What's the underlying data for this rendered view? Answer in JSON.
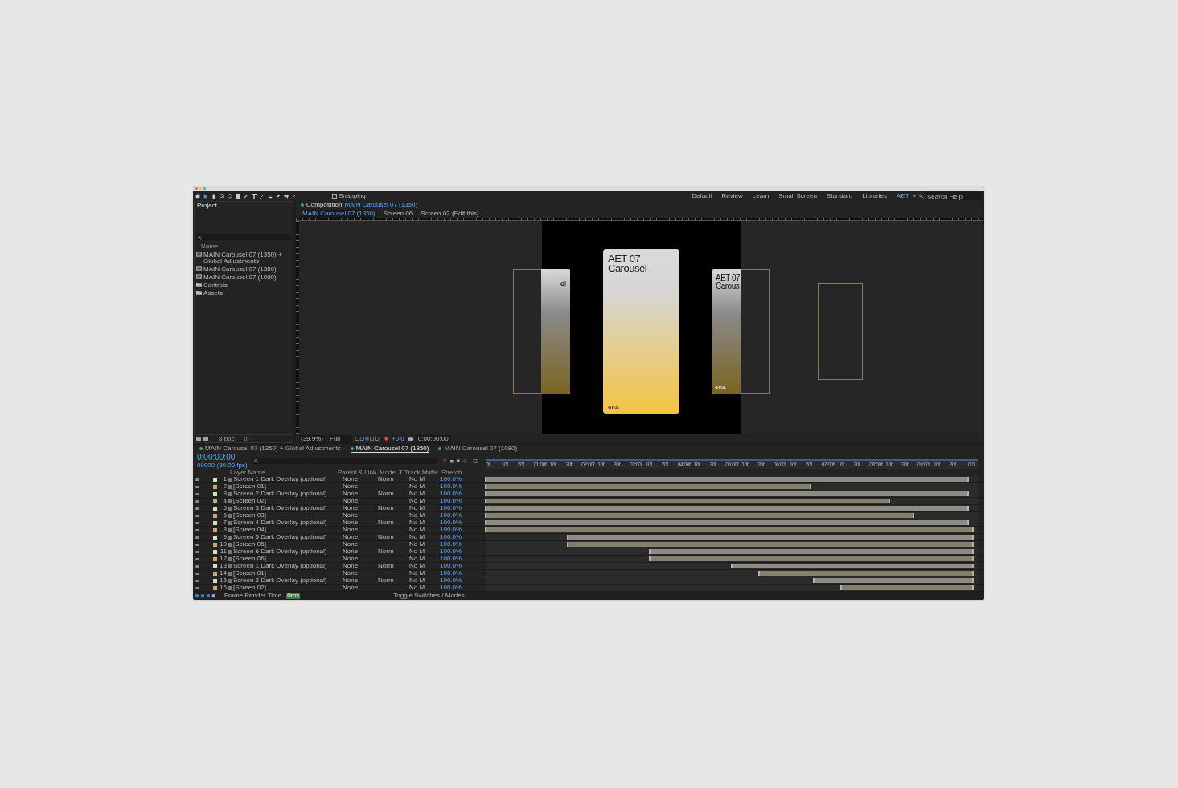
{
  "toolbar": {
    "snapping": {
      "label": "Snapping",
      "checked": false
    },
    "workspaces": [
      {
        "label": "Default",
        "selected": false
      },
      {
        "label": "Review",
        "selected": false
      },
      {
        "label": "Learn",
        "selected": false
      },
      {
        "label": "Small Screen",
        "selected": false
      },
      {
        "label": "Standard",
        "selected": false
      },
      {
        "label": "Libraries",
        "selected": false
      },
      {
        "label": "AET",
        "selected": true
      }
    ],
    "more": "»",
    "search": {
      "placeholder": "Search Help"
    }
  },
  "project": {
    "title": "Project",
    "name_column": "Name",
    "items": [
      {
        "kind": "comp",
        "label": "MAIN Carousel 07 (1350) + Global Adjustments"
      },
      {
        "kind": "comp",
        "label": "MAIN Carousel 07 (1350)"
      },
      {
        "kind": "comp",
        "label": "MAIN Carousel 07 (1080)"
      },
      {
        "kind": "folder",
        "label": "Controls"
      },
      {
        "kind": "folder",
        "label": "Assets"
      }
    ],
    "bit_depth": "8 bpc"
  },
  "composition": {
    "panel_label": "Composition",
    "panel_comp": "MAIN Carousel 07 (1350)",
    "tabs": [
      {
        "label": "MAIN Carousel 07 (1350)",
        "selected": true
      },
      {
        "label": "Screen 06",
        "selected": false
      },
      {
        "label": "Screen 02 (Edit this)",
        "selected": false
      }
    ],
    "cards": [
      {
        "kind": "left",
        "title_lines": [
          "el"
        ]
      },
      {
        "kind": "center",
        "title_lines": [
          "AET 07",
          "Carousel"
        ],
        "footer": "ena"
      },
      {
        "kind": "right",
        "title_lines": [
          "AET 07",
          "Carous"
        ],
        "footer": "ena"
      },
      {
        "kind": "ghost"
      }
    ],
    "zoom": "(39.9%)",
    "resolution": "Full",
    "exposure": "+0.0",
    "timecode": "0:00:00:00"
  },
  "timeline": {
    "tabs": [
      {
        "label": "MAIN Carousel 07 (1350) + Global Adjustments",
        "selected": false
      },
      {
        "label": "MAIN Carousel 07 (1350)",
        "selected": true
      },
      {
        "label": "MAIN Carousel 07 (1080)",
        "selected": false
      }
    ],
    "timecode": "0:00:00:00",
    "fps": "00000 (30.00 fps)",
    "columns": [
      "Layer Name",
      "Parent & Link",
      "Mode",
      "T",
      "Track Matte",
      "Stretch"
    ],
    "ruler": [
      "0f",
      "10f",
      "20f",
      "01:00f",
      "10f",
      "20f",
      "02:00f",
      "10f",
      "20f",
      "03:00f",
      "10f",
      "20f",
      "04:00f",
      "10f",
      "20f",
      "05:00f",
      "10f",
      "20f",
      "06:00f",
      "10f",
      "20f",
      "07:00f",
      "10f",
      "20f",
      "08:00f",
      "10f",
      "20f",
      "09:00f",
      "10f",
      "20f",
      "10:0"
    ],
    "layers": [
      {
        "kind": "overlay",
        "number": "1",
        "name": "Screen 1 Dark Overlay (optional)",
        "parent": "None",
        "mode": "Norm",
        "matte": "No M",
        "stretch": "100.0%",
        "start": {
          "level": 0
        },
        "end": {
          "level": 0.98
        }
      },
      {
        "kind": "screen",
        "number": "2",
        "name": "[Screen 01]",
        "parent": "None",
        "matte": "No M",
        "stretch": "100.0%",
        "start": {
          "level": 0
        },
        "end": {
          "level": 0.66
        }
      },
      {
        "kind": "overlay",
        "number": "3",
        "name": "Screen 2 Dark Overlay (optional)",
        "parent": "None",
        "mode": "Norm",
        "matte": "No M",
        "stretch": "100.0%",
        "start": {
          "level": 0
        },
        "end": {
          "level": 0.98
        }
      },
      {
        "kind": "screen",
        "number": "4",
        "name": "[Screen 02]",
        "parent": "None",
        "matte": "No M",
        "stretch": "100.0%",
        "start": {
          "level": 0
        },
        "end": {
          "level": 0.82
        }
      },
      {
        "kind": "overlay",
        "number": "5",
        "name": "Screen 3 Dark Overlay (optional)",
        "parent": "None",
        "mode": "Norm",
        "matte": "No M",
        "stretch": "100.0%",
        "start": {
          "level": 0
        },
        "end": {
          "level": 0.98
        }
      },
      {
        "kind": "screen",
        "number": "6",
        "name": "[Screen 03]",
        "parent": "None",
        "matte": "No M",
        "stretch": "100.0%",
        "start": {
          "level": 0
        },
        "end": {
          "level": 0.87
        }
      },
      {
        "kind": "overlay",
        "number": "7",
        "name": "Screen 4 Dark Overlay (optional)",
        "parent": "None",
        "mode": "Norm",
        "matte": "No M",
        "stretch": "100.0%",
        "start": {
          "level": 0
        },
        "end": {
          "level": 0.98
        }
      },
      {
        "kind": "screen",
        "number": "8",
        "name": "[Screen 04]",
        "parent": "None",
        "matte": "No M",
        "stretch": "100.0%",
        "start": {
          "level": 0
        },
        "end": {
          "level": 0.99
        }
      },
      {
        "kind": "overlay",
        "number": "9",
        "name": "Screen 5 Dark Overlay (optional)",
        "parent": "None",
        "mode": "Norm",
        "matte": "No M",
        "stretch": "100.0%",
        "start": {
          "level": 0.167
        },
        "end": {
          "level": 0.99
        }
      },
      {
        "kind": "screen",
        "number": "10",
        "name": "[Screen 05]",
        "parent": "None",
        "matte": "No M",
        "stretch": "100.0%",
        "start": {
          "level": 0.167
        },
        "end": {
          "level": 0.99
        }
      },
      {
        "kind": "overlay",
        "number": "11",
        "name": "Screen 6 Dark Overlay (optional)",
        "parent": "None",
        "mode": "Norm",
        "matte": "No M",
        "stretch": "100.0%",
        "start": {
          "level": 0.333
        },
        "end": {
          "level": 0.99
        }
      },
      {
        "kind": "screen",
        "number": "12",
        "name": "[Screen 06]",
        "parent": "None",
        "matte": "No M",
        "stretch": "100.0%",
        "start": {
          "level": 0.333
        },
        "end": {
          "level": 0.99
        }
      },
      {
        "kind": "overlay",
        "number": "13",
        "name": "Screen 1 Dark Overlay (optional)",
        "parent": "None",
        "mode": "Norm",
        "matte": "No M",
        "stretch": "100.0%",
        "start": {
          "level": 0.5
        },
        "end": {
          "level": 0.99
        }
      },
      {
        "kind": "screen",
        "number": "14",
        "name": "[Screen 01]",
        "parent": "None",
        "matte": "No M",
        "stretch": "100.0%",
        "start": {
          "level": 0.556
        },
        "end": {
          "level": 0.99
        }
      },
      {
        "kind": "overlay",
        "number": "15",
        "name": "Screen 2 Dark Overlay (optional)",
        "parent": "None",
        "mode": "Norm",
        "matte": "No M",
        "stretch": "100.0%",
        "start": {
          "level": 0.667
        },
        "end": {
          "level": 0.99
        }
      },
      {
        "kind": "screen",
        "number": "16",
        "name": "[Screen 02]",
        "parent": "None",
        "matte": "No M",
        "stretch": "100.0%",
        "start": {
          "level": 0.722
        },
        "end": {
          "level": 0.99
        }
      }
    ],
    "render_label": "Frame Render Time",
    "render_time": "0ms",
    "toggle": "Toggle Switches / Modes"
  }
}
